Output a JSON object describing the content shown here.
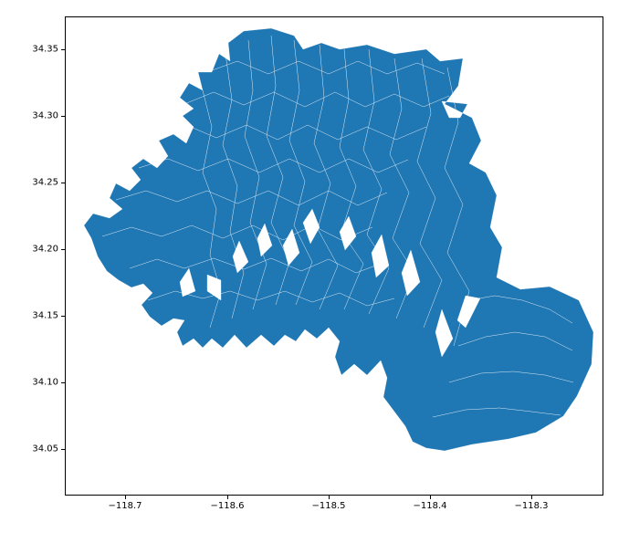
{
  "chart_data": {
    "type": "map",
    "title": "",
    "xlabel": "",
    "ylabel": "",
    "x_ticks": [
      -118.7,
      -118.6,
      -118.5,
      -118.4,
      -118.3
    ],
    "y_ticks": [
      34.05,
      34.1,
      34.15,
      34.2,
      34.25,
      34.3,
      34.35
    ],
    "x_range": [
      -118.76,
      -118.23
    ],
    "y_range": [
      34.015,
      34.375
    ],
    "fill_color": "#1f77b4",
    "region_description": "Choropleth-style polygon map of an irregular geographic region (longitude approx −118.74 to −118.25, latitude approx 34.02 to 34.36). Filled uniformly in matplotlib default blue with thin white internal boundaries between many small sub-polygons.",
    "data_extent": {
      "lon_min": -118.74,
      "lon_max": -118.25,
      "lat_min": 34.02,
      "lat_max": 34.36
    }
  },
  "xticklabels": {
    "0": "−118.7",
    "1": "−118.6",
    "2": "−118.5",
    "3": "−118.4",
    "4": "−118.3"
  },
  "yticklabels": {
    "0": "34.05",
    "1": "34.10",
    "2": "34.15",
    "3": "34.20",
    "4": "34.25",
    "5": "34.30",
    "6": "34.35"
  }
}
